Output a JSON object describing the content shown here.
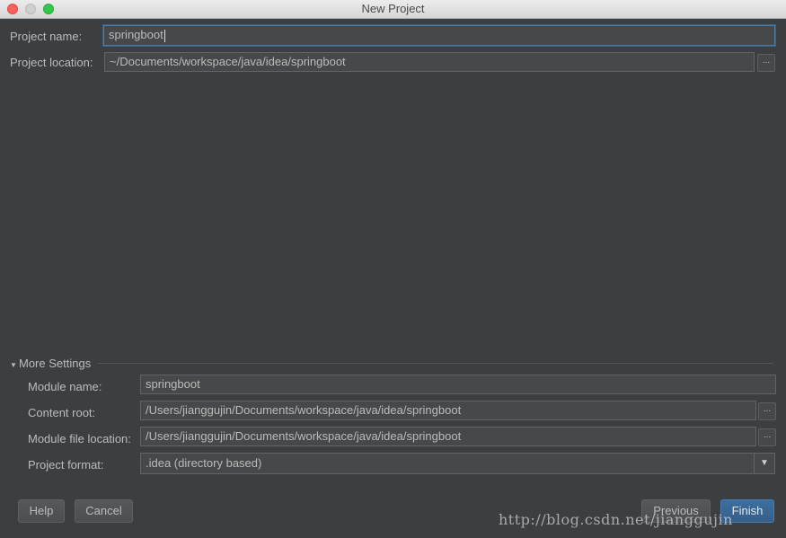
{
  "window": {
    "title": "New Project"
  },
  "project": {
    "name_label": "Project name:",
    "name_value": "springboot",
    "location_label": "Project location:",
    "location_value": "~/Documents/workspace/java/idea/springboot",
    "browse_label": "..."
  },
  "more_settings": {
    "toggle_label": "More Settings",
    "module_name_label": "Module name:",
    "module_name_value": "springboot",
    "content_root_label": "Content root:",
    "content_root_value": "/Users/jianggujin/Documents/workspace/java/idea/springboot",
    "module_file_label": "Module file location:",
    "module_file_value": "/Users/jianggujin/Documents/workspace/java/idea/springboot",
    "format_label": "Project format:",
    "format_value": ".idea (directory based)",
    "browse_label": "..."
  },
  "buttons": {
    "help": "Help",
    "cancel": "Cancel",
    "previous": "Previous",
    "finish": "Finish"
  },
  "watermark": "http://blog.csdn.net/jianggujin"
}
